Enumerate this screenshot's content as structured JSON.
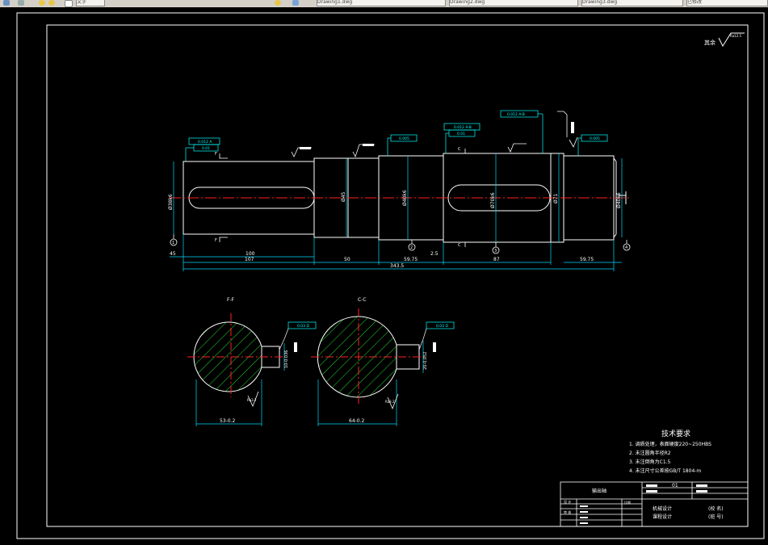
{
  "toolbar": {
    "tabs": [
      {
        "label": "文字"
      },
      {
        "label": "Drawing1.dwg"
      },
      {
        "label": "Drawing2.dwg"
      },
      {
        "label": "Drawing3.dwg"
      },
      {
        "label": "已修改"
      }
    ]
  },
  "drawing": {
    "roughness_note": "其余",
    "roughness_value": "Ra12.5",
    "dimensions": {
      "d45": "45",
      "d100": "100",
      "d107": "107",
      "d50": "50",
      "d5975a": "59.75",
      "d25": "2.5",
      "d87": "87",
      "d5975b": "59.75",
      "overall": "343.5",
      "dia_a": "Ø38k6",
      "dia_b": "Ø45",
      "dia_c": "Ø40k6",
      "dia_d": "Ø70k6",
      "dia_e": "Ø71",
      "dia_f": "Ø40k6"
    },
    "tolerances": {
      "runout_a": "0.012 A",
      "parallel_a": "0.01",
      "flat_b": "0.005",
      "runout_b": "0.012 A-B",
      "parallel_b": "0.01",
      "runout_c": "0.012 A-B",
      "flat_c": "0.005"
    },
    "labels": {
      "sec_f": "F",
      "sec_c": "C",
      "datum_1": "1",
      "datum_2": "2",
      "datum_3": "3",
      "datum_4": "4"
    },
    "sections": [
      {
        "title": "F-F",
        "width_label": "53-0.2",
        "key_label": "10-0.036",
        "tol": "0.03 D",
        "ra": "Ra3.2"
      },
      {
        "title": "C-C",
        "width_label": "64-0.2",
        "key_label": "20-0.052",
        "tol": "0.03 D",
        "ra": "Ra3.2"
      }
    ]
  },
  "tech_requirements": {
    "title": "技术要求",
    "items": [
      "1. 调质处理，表面硬度220~250HBS",
      "2. 未注圆角半径R2",
      "3. 未注倒角为C1.5",
      "4. 未注尺寸公差按GB/T 1804-m"
    ]
  },
  "title_block": {
    "part_name": "输出轴",
    "scale": "比例",
    "designer": "设 计",
    "checker": "审 核",
    "course": "机械设计",
    "course2": "课程设计",
    "school": "(校 名)",
    "class_no": "(班 号)",
    "sheet": "01"
  },
  "colors": {
    "outline": "#ffffff",
    "dim": "#00d8ff",
    "center": "#ff2020",
    "hatch": "#22dd33",
    "tol": "#00ffff"
  }
}
